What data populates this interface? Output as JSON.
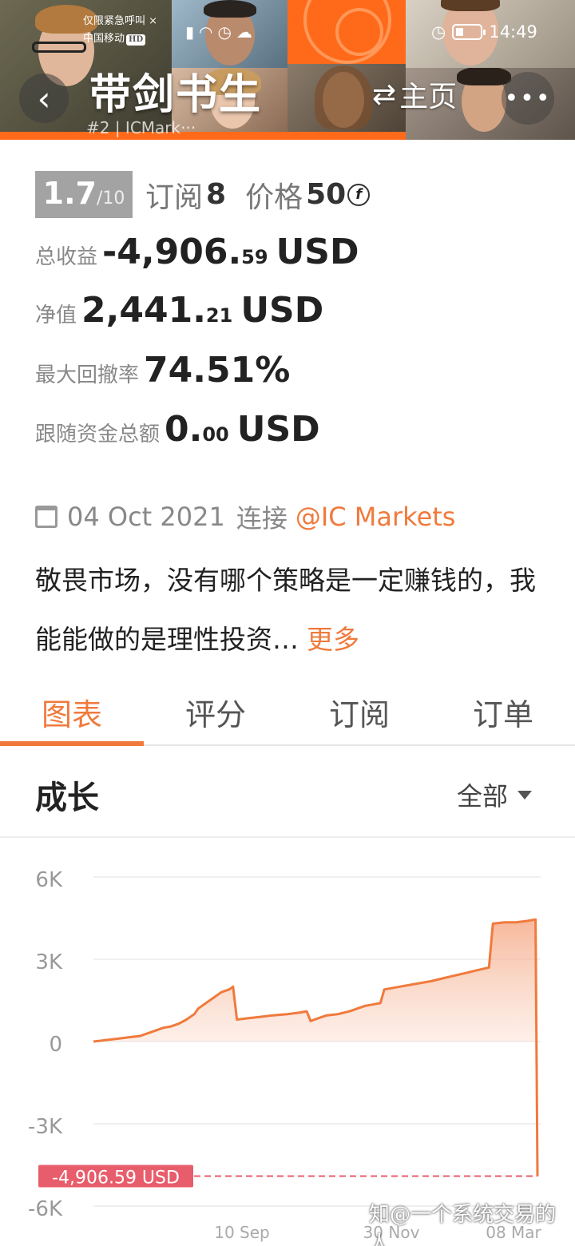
{
  "status_bar": {
    "emergency_text": "仅限紧急呼叫",
    "carrier": "中国移动",
    "hd": "HD",
    "time": "14:49"
  },
  "header": {
    "title": "带剑书生",
    "subtitle": "#2 | ICMark···",
    "home_label": "主页",
    "back_icon": "chevron-left-icon",
    "more_icon": "ellipsis-icon"
  },
  "rating": {
    "score": "1.7",
    "score_max": "/10",
    "subscribe_label": "订阅",
    "subscribe_count": "8",
    "price_label": "价格",
    "price_value": "50",
    "price_currency_symbol": "f"
  },
  "stats": {
    "total_profit_label": "总收益",
    "total_profit_int": "-4,906.",
    "total_profit_frac": "59",
    "total_profit_unit": "USD",
    "equity_label": "净值",
    "equity_int": "2,441.",
    "equity_frac": "21",
    "equity_unit": "USD",
    "max_drawdown_label": "最大回撤率",
    "max_drawdown_value": "74.51%",
    "follow_total_label": "跟随资金总额",
    "follow_total_int": "0.",
    "follow_total_frac": "00",
    "follow_total_unit": "USD"
  },
  "connection": {
    "date": "04 Oct 2021",
    "label": "连接",
    "broker": "@IC Markets"
  },
  "description": {
    "text": "敬畏市场，没有哪个策略是一定赚钱的，我能能做的是理性投资…",
    "more_label": "更多"
  },
  "tabs": [
    {
      "label": "图表",
      "active": true
    },
    {
      "label": "评分",
      "active": false
    },
    {
      "label": "订阅",
      "active": false
    },
    {
      "label": "订单",
      "active": false
    }
  ],
  "growth": {
    "title": "成长",
    "range_label": "全部"
  },
  "colors": {
    "accent": "#f07a3c",
    "header_orange": "#ff6a1a",
    "negative_badge": "#e85d6b"
  },
  "chart_data": {
    "type": "area",
    "yticks": [
      "6K",
      "3K",
      "0",
      "-3K",
      "-6K"
    ],
    "xticks": [
      "10 Sep",
      "30 Nov",
      "08 Mar"
    ],
    "ylim": [
      -6000,
      6000
    ],
    "current_value_label": "-4,906.59 USD",
    "current_value": -4906.59,
    "series": [
      {
        "points": [
          [
            0,
            0
          ],
          [
            0.03,
            50
          ],
          [
            0.06,
            100
          ],
          [
            0.09,
            150
          ],
          [
            0.12,
            200
          ],
          [
            0.14,
            300
          ],
          [
            0.16,
            400
          ],
          [
            0.18,
            500
          ],
          [
            0.2,
            550
          ],
          [
            0.22,
            650
          ],
          [
            0.24,
            800
          ],
          [
            0.26,
            1000
          ],
          [
            0.27,
            1200
          ],
          [
            0.29,
            1400
          ],
          [
            0.31,
            1600
          ],
          [
            0.33,
            1800
          ],
          [
            0.35,
            1900
          ],
          [
            0.36,
            2000
          ],
          [
            0.37,
            800
          ],
          [
            0.4,
            850
          ],
          [
            0.43,
            900
          ],
          [
            0.46,
            950
          ],
          [
            0.5,
            1000
          ],
          [
            0.53,
            1050
          ],
          [
            0.55,
            1100
          ],
          [
            0.56,
            750
          ],
          [
            0.58,
            850
          ],
          [
            0.6,
            950
          ],
          [
            0.63,
            1000
          ],
          [
            0.66,
            1100
          ],
          [
            0.68,
            1200
          ],
          [
            0.7,
            1300
          ],
          [
            0.72,
            1350
          ],
          [
            0.74,
            1400
          ],
          [
            0.75,
            1900
          ],
          [
            0.79,
            2000
          ],
          [
            0.83,
            2100
          ],
          [
            0.87,
            2200
          ],
          [
            0.9,
            2300
          ],
          [
            0.93,
            2400
          ],
          [
            0.96,
            2500
          ],
          [
            0.99,
            2600
          ],
          [
            1.02,
            2700
          ],
          [
            1.03,
            4300
          ],
          [
            1.06,
            4350
          ],
          [
            1.09,
            4350
          ],
          [
            1.12,
            4400
          ],
          [
            1.14,
            4450
          ],
          [
            1.145,
            -4906.59
          ]
        ]
      }
    ]
  }
}
